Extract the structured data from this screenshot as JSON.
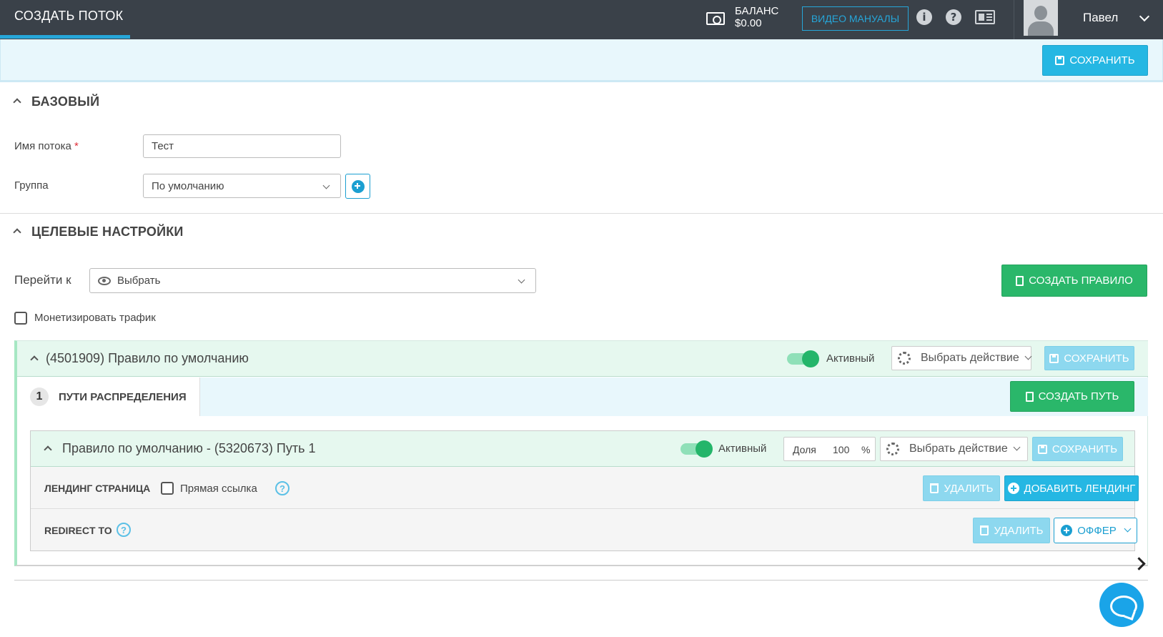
{
  "header": {
    "title": "СОЗДАТЬ ПОТОК",
    "balance_label": "БАЛАНС",
    "balance_value": "$0.00",
    "video_manuals": "ВИДЕО МАНУАЛЫ",
    "user_name": "Павел"
  },
  "toolbar": {
    "save_label": "СОХРАНИТЬ"
  },
  "basic": {
    "heading": "БАЗОВЫЙ",
    "stream_name_label": "Имя потока",
    "stream_name_required": "*",
    "stream_name_value": "Тест",
    "group_label": "Группа",
    "group_value": "По умолчанию"
  },
  "target": {
    "heading": "ЦЕЛЕВЫЕ НАСТРОЙКИ",
    "goto_label": "Перейти к",
    "goto_value": "Выбрать",
    "create_rule": "СОЗДАТЬ ПРАВИЛО",
    "monetize_label": "Монетизировать трафик"
  },
  "rule": {
    "title": "(4501909) Правило по умолчанию",
    "active_label": "Активный",
    "action_select": "Выбрать действие",
    "save": "СОХРАНИТЬ",
    "tab_number": "1",
    "tab_label": "ПУТИ РАСПРЕДЕЛЕНИЯ",
    "create_path": "СОЗДАТЬ ПУТЬ"
  },
  "path": {
    "title": "Правило по умолчанию - (5320673) Путь 1",
    "active_label": "Активный",
    "share_label": "Доля",
    "share_value": "100",
    "share_unit": "%",
    "action_select": "Выбрать действие",
    "save": "СОХРАНИТЬ",
    "landing_label": "ЛЕНДИНГ СТРАНИЦА",
    "direct_link_label": "Прямая ссылка",
    "delete_label": "УДАЛИТЬ",
    "add_landing": "ДОБАВИТЬ ЛЕНДИНГ",
    "redirect_label": "REDIRECT TO",
    "offer_label": "ОФФЕР"
  },
  "colors": {
    "topbar": "#3a4149",
    "accent_cyan": "#25b7e3",
    "accent_green": "#2ab76a",
    "rule_header_bg": "#e6f8ef",
    "subbar_bg": "#e8f7fc"
  }
}
